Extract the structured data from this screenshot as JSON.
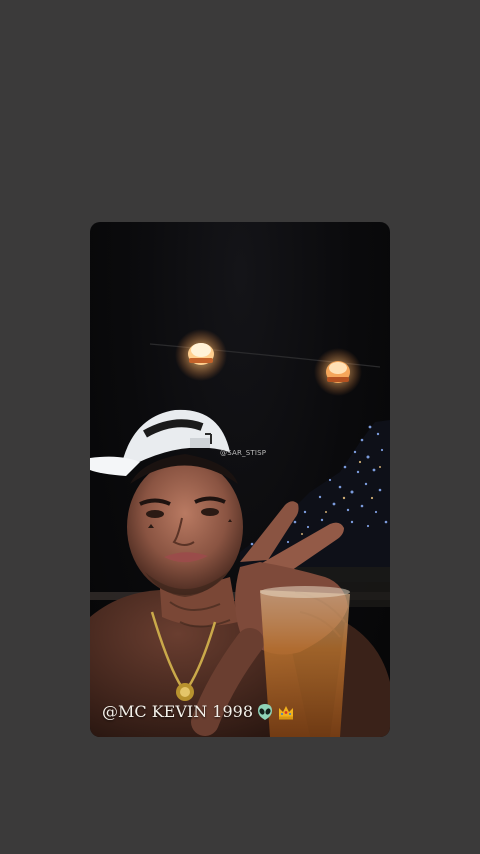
{
  "story": {
    "watermark_handle": "@SAR_STISP",
    "caption": "@MC KEVIN 1998",
    "caption_icons": [
      "alien-emoji-icon",
      "crown-emoji-icon"
    ]
  },
  "colors": {
    "page_background": "#3b3a3a",
    "card_background": "#0a0a0c",
    "caption_text": "#f4f1ea",
    "lamp_glow": "#ffd9a0",
    "city_lights": "#8fb4ff",
    "cap_white": "#e9ecef"
  }
}
